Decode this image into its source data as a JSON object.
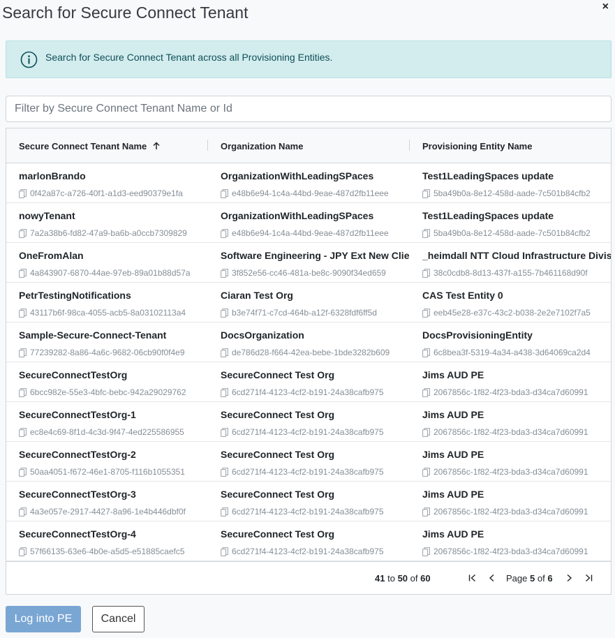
{
  "modal": {
    "title": "Search for Secure Connect Tenant",
    "close_label": "×"
  },
  "alert": {
    "text": "Search for Secure Connect Tenant across all Provisioning Entities."
  },
  "filter": {
    "placeholder": "Filter by Secure Connect Tenant Name or Id",
    "value": ""
  },
  "table": {
    "columns": [
      {
        "label": "Secure Connect Tenant Name",
        "sorted": "asc"
      },
      {
        "label": "Organization Name"
      },
      {
        "label": "Provisioning Entity Name"
      }
    ],
    "rows": [
      {
        "tenant": "marlonBrando",
        "tenant_id": "0f42a87c-a726-40f1-a1d3-eed90379e1fa",
        "org": "OrganizationWithLeadingSPaces",
        "org_id": "e48b6e94-1c4a-44bd-9eae-487d2fb11eee",
        "pe": "Test1LeadingSpaces update",
        "pe_id": "5ba49b0a-8e12-458d-aade-7c501b84cfb2"
      },
      {
        "tenant": "nowyTenant",
        "tenant_id": "7a2a38b6-fd82-47a9-ba6b-a0ccb7309829",
        "org": "OrganizationWithLeadingSPaces",
        "org_id": "e48b6e94-1c4a-44bd-9eae-487d2fb11eee",
        "pe": "Test1LeadingSpaces update",
        "pe_id": "5ba49b0a-8e12-458d-aade-7c501b84cfb2"
      },
      {
        "tenant": "OneFromAlan",
        "tenant_id": "4a843907-6870-44ae-97eb-89a01b88d57a",
        "org": "Software Engineering - JPY Ext New Clie",
        "org_id": "3f852e56-cc46-481a-be8c-9090f34ed659",
        "pe": "_heimdall NTT Cloud Infrastructure Divis",
        "pe_id": "38c0cdb8-8d13-437f-a155-7b461168d90f"
      },
      {
        "tenant": "PetrTestingNotifications",
        "tenant_id": "43117b6f-98ca-4055-acb5-8a03102113a4",
        "org": "Ciaran Test Org",
        "org_id": "b3e74f71-c7cd-464b-a12f-6328fdf6ff5d",
        "pe": "CAS Test Entity 0",
        "pe_id": "eeb45e28-e37c-43c2-b038-2e2e7102f7a5"
      },
      {
        "tenant": "Sample-Secure-Connect-Tenant",
        "tenant_id": "77239282-8a86-4a6c-9682-06cb90f0f4e9",
        "org": "DocsOrganization",
        "org_id": "de786d28-f664-42ea-bebe-1bde3282b609",
        "pe": "DocsProvisioningEntity",
        "pe_id": "6c8bea3f-5319-4a34-a438-3d64069ca2d4"
      },
      {
        "tenant": "SecureConnectTestOrg",
        "tenant_id": "6bcc982e-55e3-4bfc-bebc-942a29029762",
        "org": "SecureConnect Test Org",
        "org_id": "6cd271f4-4123-4cf2-b191-24a38cafb975",
        "pe": "Jims AUD PE",
        "pe_id": "2067856c-1f82-4f23-bda3-d34ca7d60991"
      },
      {
        "tenant": "SecureConnectTestOrg-1",
        "tenant_id": "ec8e4c69-8f1d-4c3d-9f47-4ed225586955",
        "org": "SecureConnect Test Org",
        "org_id": "6cd271f4-4123-4cf2-b191-24a38cafb975",
        "pe": "Jims AUD PE",
        "pe_id": "2067856c-1f82-4f23-bda3-d34ca7d60991"
      },
      {
        "tenant": "SecureConnectTestOrg-2",
        "tenant_id": "50aa4051-f672-46e1-8705-f116b1055351",
        "org": "SecureConnect Test Org",
        "org_id": "6cd271f4-4123-4cf2-b191-24a38cafb975",
        "pe": "Jims AUD PE",
        "pe_id": "2067856c-1f82-4f23-bda3-d34ca7d60991"
      },
      {
        "tenant": "SecureConnectTestOrg-3",
        "tenant_id": "4a3e057e-2917-4427-8a96-1e4b446dbf0f",
        "org": "SecureConnect Test Org",
        "org_id": "6cd271f4-4123-4cf2-b191-24a38cafb975",
        "pe": "Jims AUD PE",
        "pe_id": "2067856c-1f82-4f23-bda3-d34ca7d60991"
      },
      {
        "tenant": "SecureConnectTestOrg-4",
        "tenant_id": "57f66135-63e6-4b0e-a5d5-e51885caefc5",
        "org": "SecureConnect Test Org",
        "org_id": "6cd271f4-4123-4cf2-b191-24a38cafb975",
        "pe": "Jims AUD PE",
        "pe_id": "2067856c-1f82-4f23-bda3-d34ca7d60991"
      }
    ]
  },
  "pagination": {
    "from": "41",
    "to_label": "to",
    "to": "50",
    "of_label": "of",
    "total": "60",
    "page_label": "Page",
    "page": "5",
    "pages": "6"
  },
  "buttons": {
    "login_label": "Log into PE",
    "cancel_label": "Cancel"
  },
  "icons": {
    "info": "info-circle-icon",
    "copy": "copy-icon",
    "sort": "arrow-up-icon",
    "first": "first-page-icon",
    "prev": "chevron-left-icon",
    "next": "chevron-right-icon",
    "last": "last-page-icon"
  },
  "colors": {
    "alert_bg": "#d3ecee",
    "alert_text": "#0c4f57",
    "primary_button": "#7aa6d4"
  }
}
